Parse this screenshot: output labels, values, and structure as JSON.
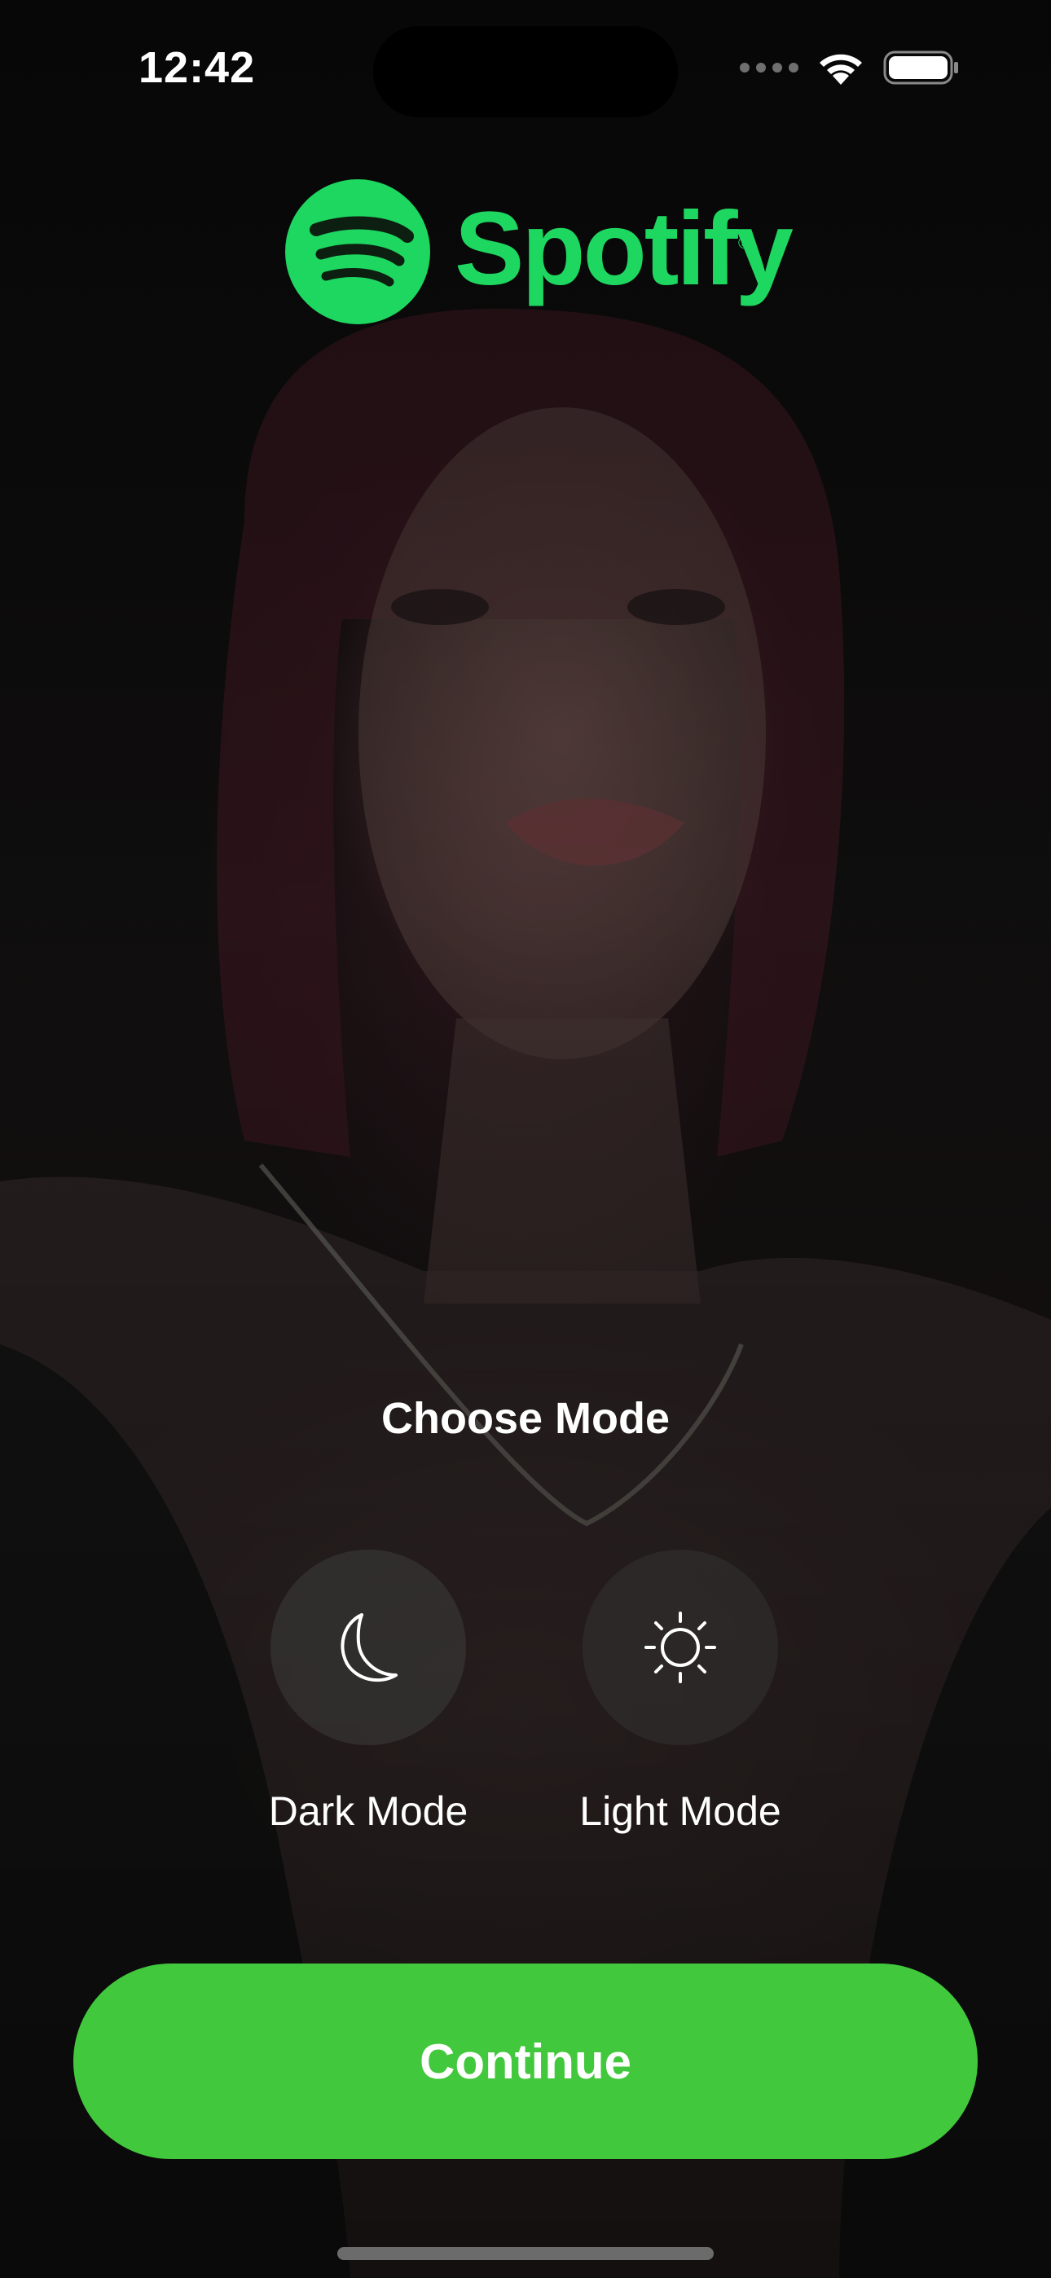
{
  "status_bar": {
    "time": "12:42"
  },
  "brand": {
    "name": "Spotify",
    "registered_mark": "®",
    "color": "#1ED760"
  },
  "mode_picker": {
    "title": "Choose Mode",
    "options": [
      {
        "label": "Dark Mode",
        "icon": "moon-icon"
      },
      {
        "label": "Light Mode",
        "icon": "sun-icon"
      }
    ]
  },
  "actions": {
    "continue_label": "Continue",
    "continue_color": "#42C83C"
  },
  "background": {
    "image": "artist-portrait-photo"
  },
  "icons": {
    "signal": "cellular-signal-icon",
    "wifi": "wifi-icon",
    "battery": "battery-icon"
  }
}
